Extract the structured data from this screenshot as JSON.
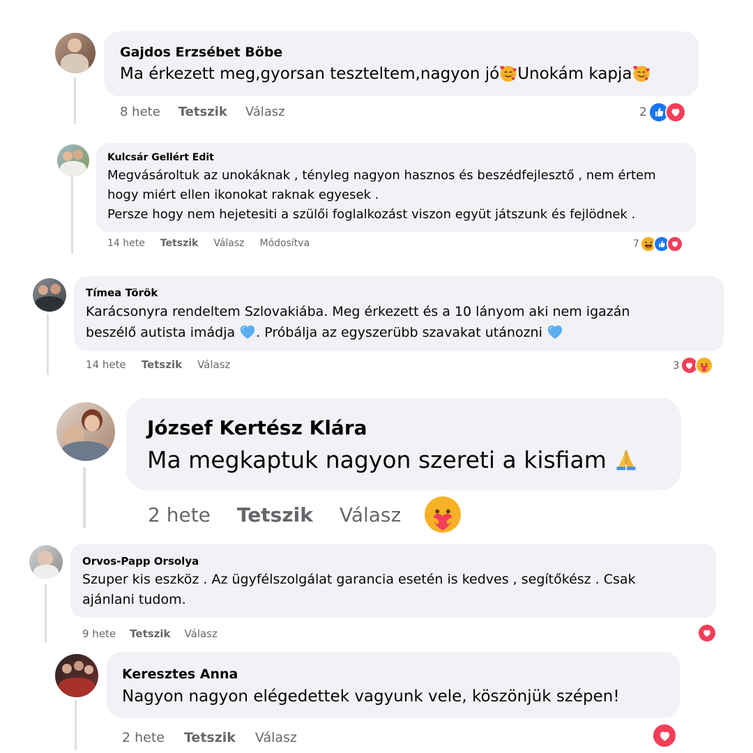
{
  "comments": [
    {
      "name": "Gajdos Erzsébet Böbe",
      "lines": [
        "Ma érkezett meg,gyorsan teszteltem,nagyon jó",
        "Unokám kapja"
      ],
      "time": "8 hete",
      "like": "Tetszik",
      "reply": "Válasz",
      "reaction_count": "2",
      "reactions": [
        "like",
        "love"
      ]
    },
    {
      "name": "Kulcsár Gellért Edit",
      "lines": [
        "Megvásároltuk az unokáknak , tényleg nagyon hasznos és beszédfejlesztő , nem értem",
        "hogy miért ellen ikonokat raknak egyesek .",
        "Persze hogy nem hejetesiti a szülői foglalkozást viszon együt játszunk és fejlödnek ."
      ],
      "time": "14 hete",
      "like": "Tetszik",
      "reply": "Válasz",
      "edited": "Módosítva",
      "reaction_count": "7",
      "reactions": [
        "haha",
        "like",
        "love"
      ]
    },
    {
      "name": "Tímea Török",
      "lines": [
        "Karácsonyra rendeltem Szlovakiába. Meg érkezett és a 10 lányom aki nem igazán",
        "beszélő autista imádja",
        ". Próbálja az egyszerübb szavakat utánozni"
      ],
      "time": "14 hete",
      "like": "Tetszik",
      "reply": "Válasz",
      "reaction_count": "3",
      "reactions": [
        "love",
        "care"
      ]
    },
    {
      "name": "József Kertész Klára",
      "lines": [
        "Ma megkaptuk nagyon szereti a kisfiam"
      ],
      "time": "2 hete",
      "like": "Tetszik",
      "reply": "Válasz",
      "reactions": [
        "care"
      ]
    },
    {
      "name": "Orvos-Papp Orsolya",
      "lines": [
        "Szuper kis eszköz . Az ügyfélszolgálat garancia esetén is kedves , segítőkész . Csak",
        "ajánlani tudom."
      ],
      "time": "9 hete",
      "like": "Tetszik",
      "reply": "Válasz",
      "reactions": [
        "love"
      ]
    },
    {
      "name": "Keresztes Anna",
      "lines": [
        "Nagyon nagyon elégedettek vagyunk vele, köszönjük szépen!"
      ],
      "time": "2 hete",
      "like": "Tetszik",
      "reply": "Válasz",
      "reactions": [
        "love"
      ]
    }
  ],
  "icons": {
    "like": "like-reaction-icon",
    "love": "love-reaction-icon",
    "haha": "haha-reaction-icon",
    "care": "care-reaction-icon",
    "smiling_hearts": "smiling-face-with-hearts-emoji",
    "blue_heart": "blue-heart-emoji",
    "folded_hands": "folded-hands-emoji"
  },
  "colors": {
    "bubble": "#f0f2f5",
    "meta_text": "#65676b",
    "like_blue": "#1877f2",
    "love_red": "#f33e58",
    "haha_yellow": "#f7b125",
    "blue_heart": "#5aaef0"
  }
}
